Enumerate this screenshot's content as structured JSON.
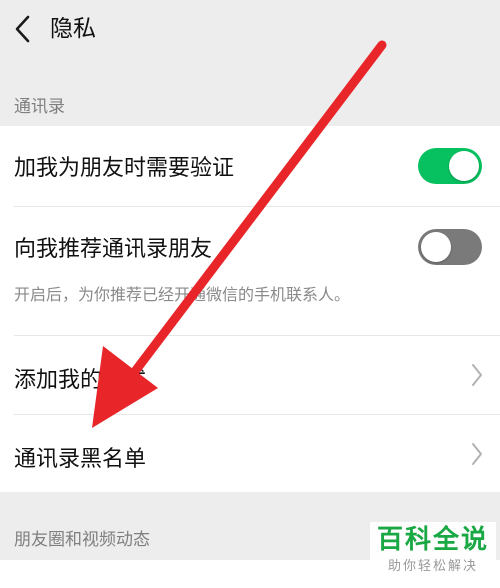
{
  "header": {
    "title": "隐私",
    "back_icon": "chevron-left-icon"
  },
  "sections": [
    {
      "label": "通讯录",
      "rows": [
        {
          "label": "加我为朋友时需要验证",
          "control": "toggle",
          "toggle_on": true
        },
        {
          "label": "向我推荐通讯录朋友",
          "description": "开启后，为你推荐已经开通微信的手机联系人。",
          "control": "toggle",
          "toggle_on": false
        },
        {
          "label": "添加我的方式",
          "control": "chevron"
        },
        {
          "label": "通讯录黑名单",
          "control": "chevron"
        }
      ]
    },
    {
      "label": "朋友圈和视频动态"
    }
  ],
  "annotation": {
    "type": "arrow",
    "color": "#e8262a"
  },
  "watermark": {
    "main": "百科全说",
    "sub": "助你轻松解决"
  },
  "colors": {
    "toggle_on": "#07c160",
    "toggle_off": "#7a7a7a",
    "background": "#ededed",
    "card": "#ffffff",
    "watermark_green": "#1aa845"
  }
}
